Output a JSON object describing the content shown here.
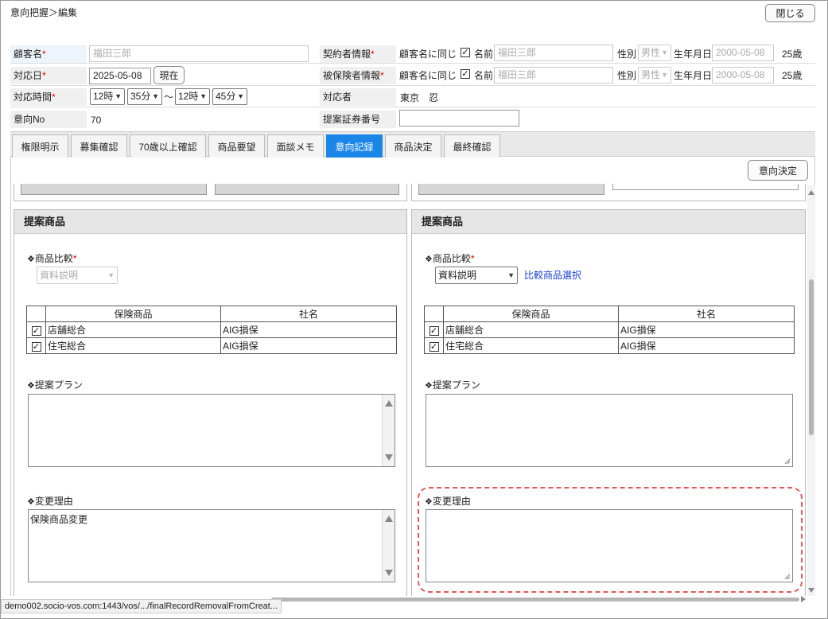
{
  "header": {
    "breadcrumb": "意向把握＞編集",
    "close_label": "閉じる"
  },
  "form": {
    "customer_label": "顧客名",
    "customer_value": "福田三郎",
    "date_label": "対応日",
    "date_value": "2025-05-08",
    "now_label": "現在",
    "time_label": "対応時間",
    "time_start_hour": "12時",
    "time_start_min": "35分",
    "tilde": "～",
    "time_end_hour": "12時",
    "time_end_min": "45分",
    "ikou_no_label": "意向No",
    "ikou_no_value": "70",
    "contractor_label": "契約者情報",
    "insured_label": "被保険者情報",
    "same_as_customer": "顧客名に同じ",
    "name_label": "名前",
    "name_value": "福田三郎",
    "gender_label": "性別",
    "gender_value": "男性",
    "birth_label": "生年月日",
    "birth_value": "2000-05-08",
    "age_value": "25歳",
    "responder_label": "対応者",
    "responder_value": "東京　忍",
    "proposal_no_label": "提案証券番号",
    "proposal_no_value": ""
  },
  "tabs": [
    "権限明示",
    "募集確認",
    "70歳以上確認",
    "商品要望",
    "面談メモ",
    "意向記録",
    "商品決定",
    "最終確認"
  ],
  "active_tab": "意向記録",
  "decide_label": "意向決定",
  "left_panel": {
    "title": "提案商品",
    "compare_label": "商品比較",
    "compare_value": "資料説明",
    "col_product": "保険商品",
    "col_company": "社名",
    "rows": [
      {
        "product": "店舗総合",
        "company": "AIG損保"
      },
      {
        "product": "住宅総合",
        "company": "AIG損保"
      }
    ],
    "plan_label": "提案プラン",
    "plan_value": "",
    "reason_label": "変更理由",
    "reason_value": "保険商品変更"
  },
  "right_panel": {
    "title": "提案商品",
    "compare_label": "商品比較",
    "compare_value": "資料説明",
    "select_link": "比較商品選択",
    "col_product": "保険商品",
    "col_company": "社名",
    "rows": [
      {
        "product": "店舗総合",
        "company": "AIG損保"
      },
      {
        "product": "住宅総合",
        "company": "AIG損保"
      }
    ],
    "plan_label": "提案プラン",
    "plan_value": "",
    "reason_label": "変更理由",
    "reason_value": ""
  },
  "status_url": "demo002.socio-vos.com:1443/vos/.../finalRecordRemovalFromCreat...",
  "colors": {
    "active_tab": "#1a86e8",
    "link": "#1a3fd6",
    "required": "#dd0000",
    "highlight_dashed": "#e05a5a"
  }
}
